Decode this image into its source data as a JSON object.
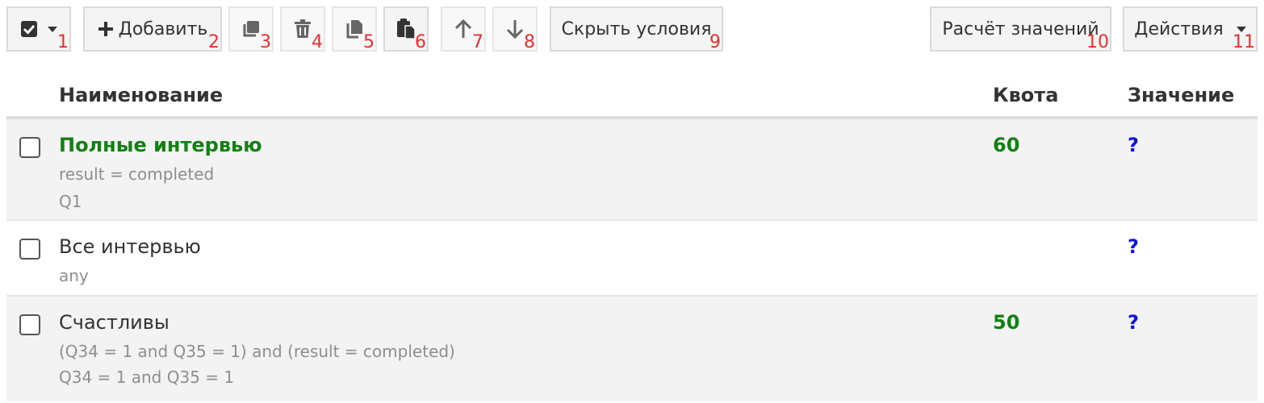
{
  "toolbar": {
    "select_all": {
      "icon": "checkbox-checked-icon",
      "dropdown_icon": "caret-down-icon",
      "num": "1"
    },
    "add": {
      "icon": "plus-icon",
      "label": "Добавить",
      "num": "2"
    },
    "duplicate": {
      "icon": "duplicate-icon",
      "num": "3"
    },
    "delete": {
      "icon": "trash-icon",
      "num": "4"
    },
    "copy": {
      "icon": "copy-icon",
      "num": "5"
    },
    "paste": {
      "icon": "paste-icon",
      "num": "6"
    },
    "move_up": {
      "icon": "arrow-up-icon",
      "num": "7"
    },
    "move_down": {
      "icon": "arrow-down-icon",
      "num": "8"
    },
    "hide_conditions": {
      "label": "Скрыть условия",
      "num": "9"
    },
    "calc_values": {
      "label": "Расчёт значений",
      "num": "10"
    },
    "actions": {
      "label": "Действия",
      "dropdown_icon": "caret-down-icon",
      "num": "11"
    }
  },
  "table": {
    "headers": {
      "name": "Наименование",
      "quota": "Квота",
      "value": "Значение"
    },
    "rows": [
      {
        "name": "Полные интервью",
        "conditions": [
          "result = completed",
          "Q1"
        ],
        "quota": "60",
        "value": "?",
        "highlight": true
      },
      {
        "name": "Все интервью",
        "conditions": [
          "any"
        ],
        "quota": "",
        "value": "?",
        "highlight": false
      },
      {
        "name": "Счастливы",
        "conditions": [
          "(Q34 = 1 and Q35 = 1) and (result = completed)",
          "Q34 = 1 and Q35 = 1"
        ],
        "quota": "50",
        "value": "?",
        "highlight": false
      }
    ]
  },
  "colors": {
    "label_number": "#e8302f",
    "quota_green": "#128012",
    "value_blue": "#1010e8",
    "condition_gray": "#8e8e8e"
  }
}
